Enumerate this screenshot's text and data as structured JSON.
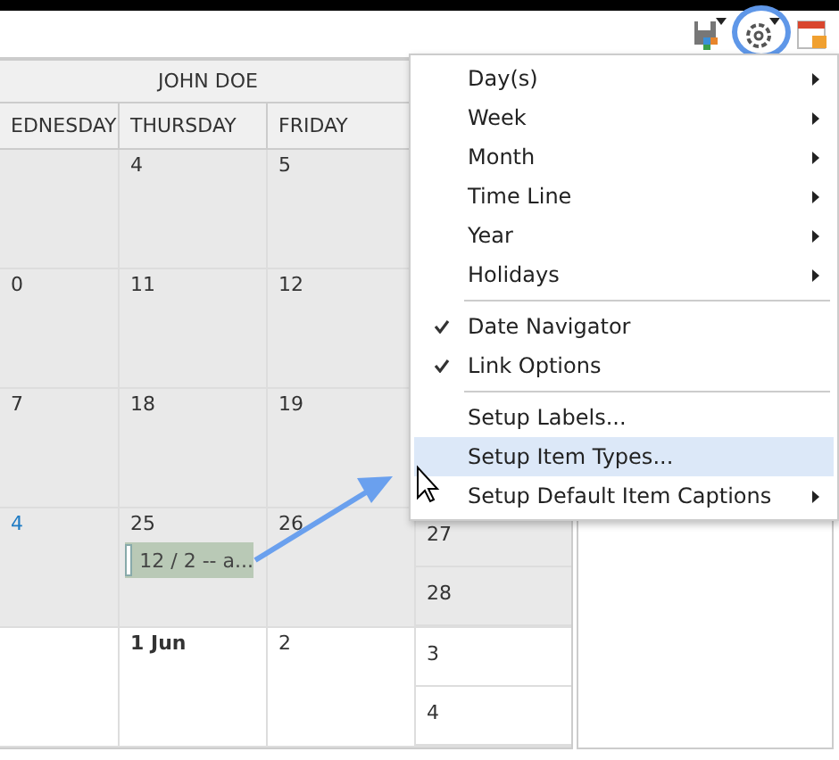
{
  "calendar": {
    "resource": "JOHN DOE",
    "columns": [
      "EDNESDAY",
      "THURSDAY",
      "FRIDAY"
    ],
    "weeks": [
      {
        "dimmed": true,
        "thursday": {
          "label": "4"
        },
        "friday": {
          "label": "5"
        }
      },
      {
        "dimmed": true,
        "wednesday": {
          "label": "0"
        },
        "thursday": {
          "label": "11"
        },
        "friday": {
          "label": "12"
        }
      },
      {
        "dimmed": true,
        "wednesday": {
          "label": "7"
        },
        "thursday": {
          "label": "18"
        },
        "friday": {
          "label": "19"
        }
      },
      {
        "dimmed": true,
        "wednesday": {
          "label": "4",
          "highlighted": true
        },
        "thursday": {
          "label": "25",
          "event": "12 / 2 -- a..."
        },
        "friday": {
          "label": "26"
        },
        "weekend": [
          "27",
          "28"
        ]
      },
      {
        "dimmed": false,
        "thursday": {
          "label": "1 Jun",
          "bold": true
        },
        "friday": {
          "label": "2"
        },
        "weekend": [
          "3",
          "4"
        ]
      }
    ]
  },
  "menu": {
    "items": [
      {
        "kind": "submenu",
        "label": "Day(s)",
        "selected": false
      },
      {
        "kind": "submenu",
        "label": "Week",
        "selected": false
      },
      {
        "kind": "submenu",
        "label": "Month",
        "selected": false
      },
      {
        "kind": "submenu",
        "label": "Time Line",
        "selected": false
      },
      {
        "kind": "submenu",
        "label": "Year",
        "selected": false
      },
      {
        "kind": "submenu",
        "label": "Holidays",
        "selected": false
      },
      {
        "kind": "separator"
      },
      {
        "kind": "check",
        "label": "Date Navigator",
        "checked": true,
        "selected": false
      },
      {
        "kind": "check",
        "label": "Link Options",
        "checked": true,
        "selected": false
      },
      {
        "kind": "separator"
      },
      {
        "kind": "command",
        "label": "Setup Labels...",
        "selected": false
      },
      {
        "kind": "command",
        "label": "Setup Item Types...",
        "selected": true
      },
      {
        "kind": "submenu",
        "label": "Setup Default Item Captions",
        "selected": false
      }
    ]
  }
}
